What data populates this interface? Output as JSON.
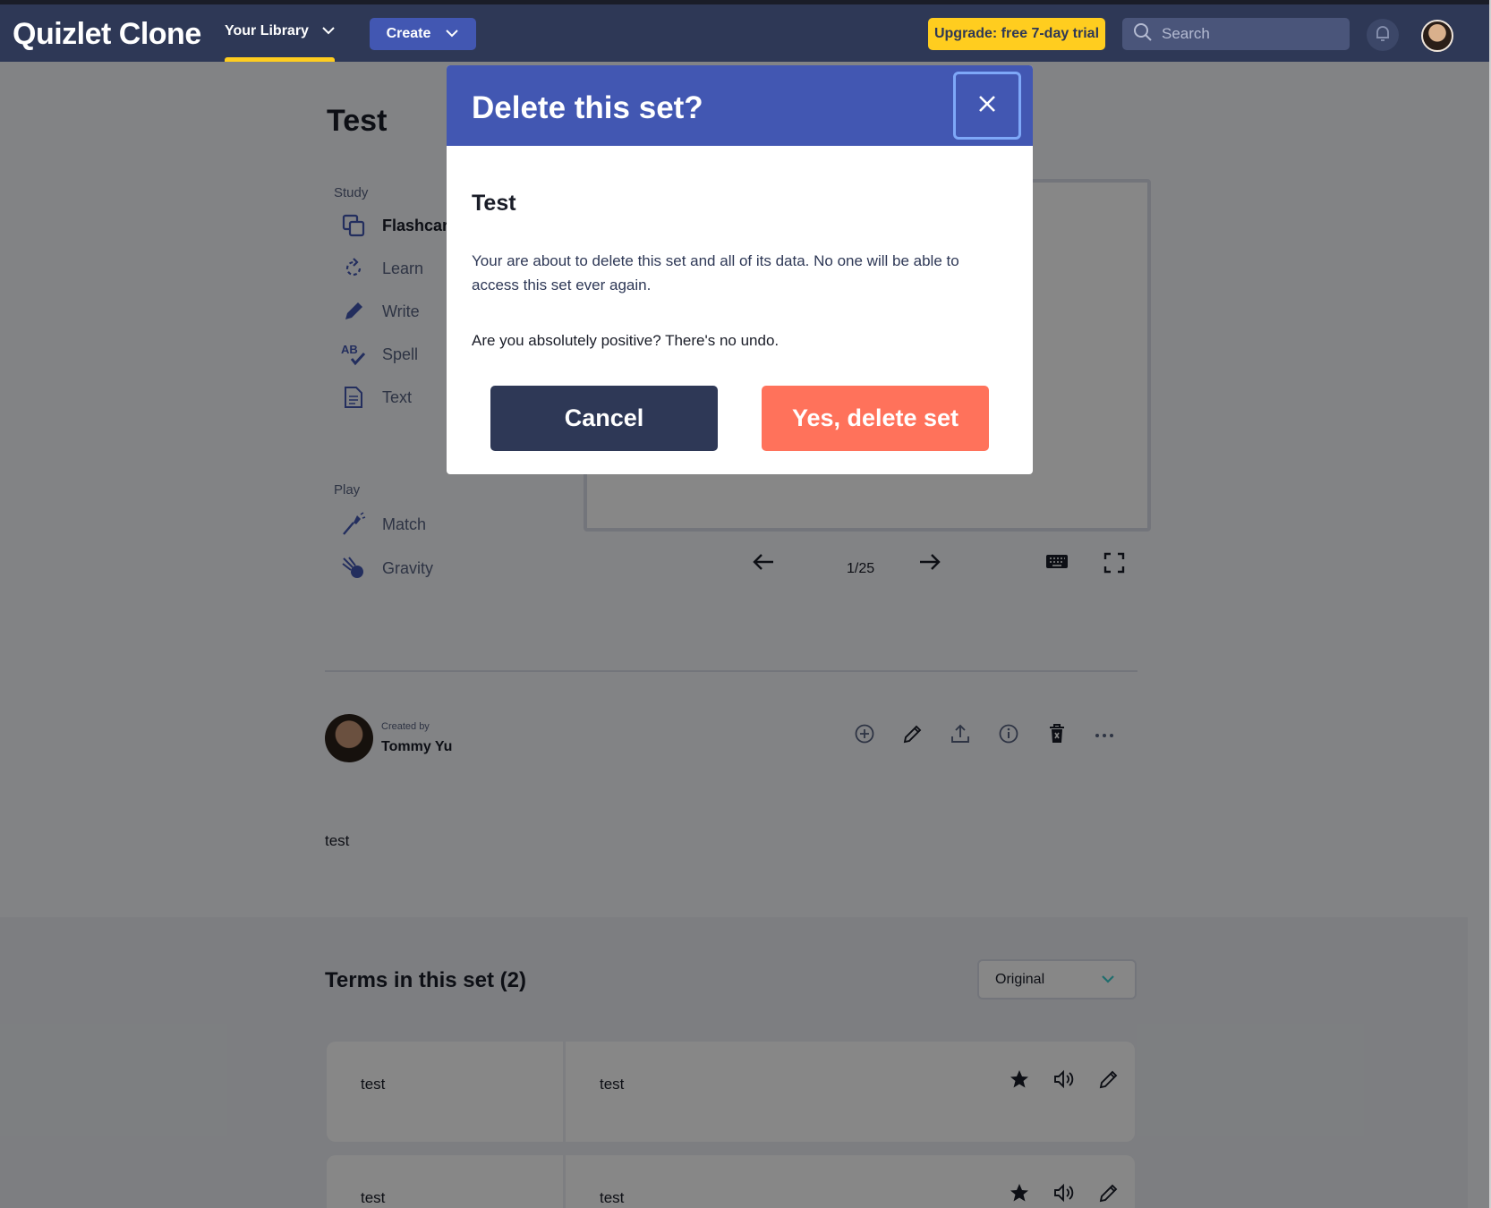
{
  "topbar": {
    "brand": "Quizlet Clone",
    "library_label": "Your Library",
    "create_label": "Create",
    "upgrade_label": "Upgrade: free 7-day trial",
    "search_placeholder": "Search"
  },
  "set": {
    "title": "Test",
    "description": "test"
  },
  "sidebar": {
    "study_heading": "Study",
    "study_items": [
      {
        "label": "Flashcards",
        "icon": "flashcards-icon"
      },
      {
        "label": "Learn",
        "icon": "learn-icon"
      },
      {
        "label": "Write",
        "icon": "pencil-icon"
      },
      {
        "label": "Spell",
        "icon": "spell-icon"
      },
      {
        "label": "Text",
        "icon": "document-icon"
      }
    ],
    "play_heading": "Play",
    "play_items": [
      {
        "label": "Match",
        "icon": "match-icon"
      },
      {
        "label": "Gravity",
        "icon": "gravity-icon"
      }
    ]
  },
  "flashcards": {
    "counter": "1/25"
  },
  "creator": {
    "created_by_label": "Created by",
    "name": "Tommy Yu"
  },
  "terms": {
    "heading": "Terms in this set (2)",
    "sort_selected": "Original",
    "rows": [
      {
        "term": "test",
        "definition": "test"
      },
      {
        "term": "test",
        "definition": "test"
      }
    ]
  },
  "modal": {
    "title": "Delete this set?",
    "set_title": "Test",
    "body": "Your are about to delete this set and all of its data. No one will be able to access this set ever again.",
    "confirm_question": "Are you absolutely positive? There's no undo.",
    "cancel_label": "Cancel",
    "delete_label": "Yes, delete set"
  },
  "colors": {
    "header_bg": "#2e3856",
    "accent_blue": "#4257b2",
    "upgrade_yellow": "#ffcd1f",
    "danger": "#ff725b"
  }
}
